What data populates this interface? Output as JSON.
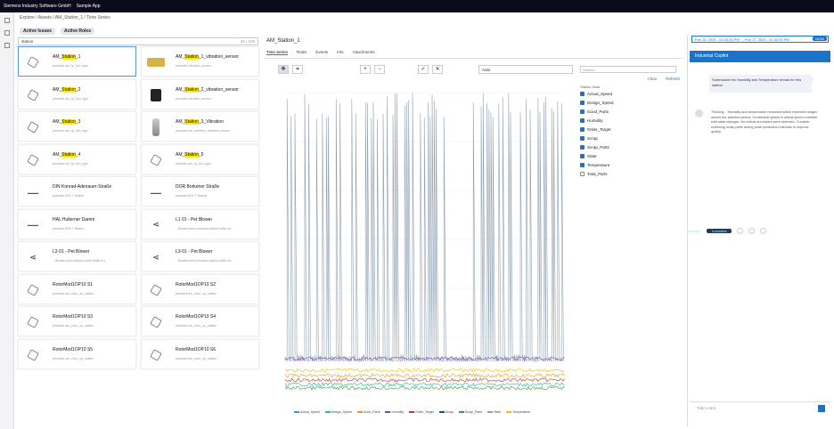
{
  "topbar": {
    "brand": "Siemens Industry Software GmbH",
    "app": "Sample App",
    "tenant": "presales",
    "tag": "Industrial"
  },
  "breadcrumb": "Explore / Assets / AM_Station_1 / Time Series",
  "filters": {
    "issues": "Active Issues",
    "roles": "Active Roles"
  },
  "search": {
    "value": "station",
    "count": "25 / 100"
  },
  "cards": [
    {
      "pre": "AM_",
      "hl": "Station",
      "post": "_1",
      "sub": "presales.am_fp_lum_type",
      "thumb": "hex",
      "sel": true
    },
    {
      "pre": "AM_",
      "hl": "Station",
      "post": "_1_vibration_sensor",
      "sub": "presales.vibration_sensor",
      "thumb": "part"
    },
    {
      "pre": "AM_",
      "hl": "Station",
      "post": "_2",
      "sub": "presales.am_fp_lum_type",
      "thumb": "hex"
    },
    {
      "pre": "AM_",
      "hl": "Station",
      "post": "_2_vibration_sensor",
      "sub": "presales.vibration_sensor",
      "thumb": "box"
    },
    {
      "pre": "AM_",
      "hl": "Station",
      "post": "_3",
      "sub": "presales.am_fp_lum_type",
      "thumb": "hex"
    },
    {
      "pre": "AM_",
      "hl": "Station",
      "post": "_3_Vibration",
      "sub": "presales.am_ambient_vibration_sensor",
      "thumb": "cyl"
    },
    {
      "pre": "AM_",
      "hl": "Station",
      "post": "_4",
      "sub": "presales.am_fp_lum_type",
      "thumb": "hex"
    },
    {
      "pre": "AM_",
      "hl": "Station",
      "post": "_5",
      "sub": "presales.am_fp_lum_type",
      "thumb": "hex"
    },
    {
      "pre": "DIN Konrad-Adenauer-Straße",
      "hl": "",
      "post": "",
      "sub": "presales.BOLY Station",
      "thumb": "logo"
    },
    {
      "pre": "DOR Borkener Straße",
      "hl": "",
      "post": "",
      "sub": "presales.BOLY Station",
      "thumb": "logo"
    },
    {
      "pre": "HAL Hullerner Damm",
      "hl": "",
      "post": "",
      "sub": "presales.BOLY Station",
      "thumb": "logo"
    },
    {
      "pre": "L1 01 - Pet Blower",
      "hl": "",
      "post": "",
      "sub": "...Blower.brew.encoded.station.bottle.m1",
      "thumb": "share"
    },
    {
      "pre": "L2-01 - Pet Blower",
      "hl": "",
      "post": "",
      "sub": "...Blower.brew.molded.pants.bottle.m1",
      "thumb": "share"
    },
    {
      "pre": "L3-01 - Pet Blower",
      "hl": "",
      "post": "",
      "sub": "...Blower.brew.encoded.station.bottle.m1",
      "thumb": "share"
    },
    {
      "pre": "RotorMod1OP10 S1",
      "hl": "",
      "post": "",
      "sub": "presales.am_rotor_op_station",
      "thumb": "hex"
    },
    {
      "pre": "RotorMod1OP10 S2",
      "hl": "",
      "post": "",
      "sub": "presales.am_rotor_op_station",
      "thumb": "hex"
    },
    {
      "pre": "RotorMod1OP10 S3",
      "hl": "",
      "post": "",
      "sub": "presales.am_rotor_op_station",
      "thumb": "hex"
    },
    {
      "pre": "RotorMod1OP10 S4",
      "hl": "",
      "post": "",
      "sub": "presales.am_rotor_op_station",
      "thumb": "hex"
    },
    {
      "pre": "RotorMod1OP10 S5",
      "hl": "",
      "post": "",
      "sub": "presales.am_rotor_op_station",
      "thumb": "hex"
    },
    {
      "pre": "RotorMod1OP10 S6",
      "hl": "",
      "post": "",
      "sub": "presales.am_rotor_op_station",
      "thumb": "hex"
    }
  ],
  "main": {
    "title": "AM_Station_1",
    "tabs": [
      "Time Series",
      "Roles",
      "Events",
      "Info",
      "Attachments"
    ],
    "select": "Auto"
  },
  "panel": {
    "search": "Search...",
    "clear": "Clear",
    "refresh": "Refresh",
    "header": "Station Data",
    "items": [
      {
        "label": "Actual_Speed",
        "on": true
      },
      {
        "label": "Design_Speed",
        "on": true
      },
      {
        "label": "Good_Parts",
        "on": true
      },
      {
        "label": "Humidity",
        "on": true
      },
      {
        "label": "Order_Target",
        "on": true
      },
      {
        "label": "Scrap",
        "on": true
      },
      {
        "label": "Scrap_Parts",
        "on": true
      },
      {
        "label": "State",
        "on": true
      },
      {
        "label": "Temperature",
        "on": true
      },
      {
        "label": "Total_Parts",
        "on": false
      }
    ]
  },
  "legend": [
    "Actual_Speed",
    "Design_Speed",
    "Good_Parts",
    "Humidity",
    "Order_Target",
    "Scrap",
    "Scrap_Parts",
    "State",
    "Temperature"
  ],
  "colors": {
    "Actual_Speed": "#4a90d9",
    "Design_Speed": "#2bb39a",
    "Good_Parts": "#e69a1a",
    "Humidity": "#7b4ab8",
    "Order_Target": "#c0392b",
    "Scrap": "#1f4e79",
    "Scrap_Parts": "#3c9a3c",
    "State": "#8fa0b0",
    "Temperature": "#e3c400"
  },
  "right": {
    "date": "Feb 15, 2025 - 02:40:00 PM → Feb 17, 2025 - 02:40:00 PM",
    "now": "NOW",
    "head": "Industrial Copilot",
    "user": "Summarize the Humidity and Temperature trends for this station.",
    "ai": "Thinking... Humidity and temperature remained within expected ranges across the selected period. Occasional spikes in actual speed correlate with state changes. No critical anomalies were detected. Consider reviewing scrap parts during peak production intervals to improve quality.",
    "input": "Talk to Bot"
  }
}
